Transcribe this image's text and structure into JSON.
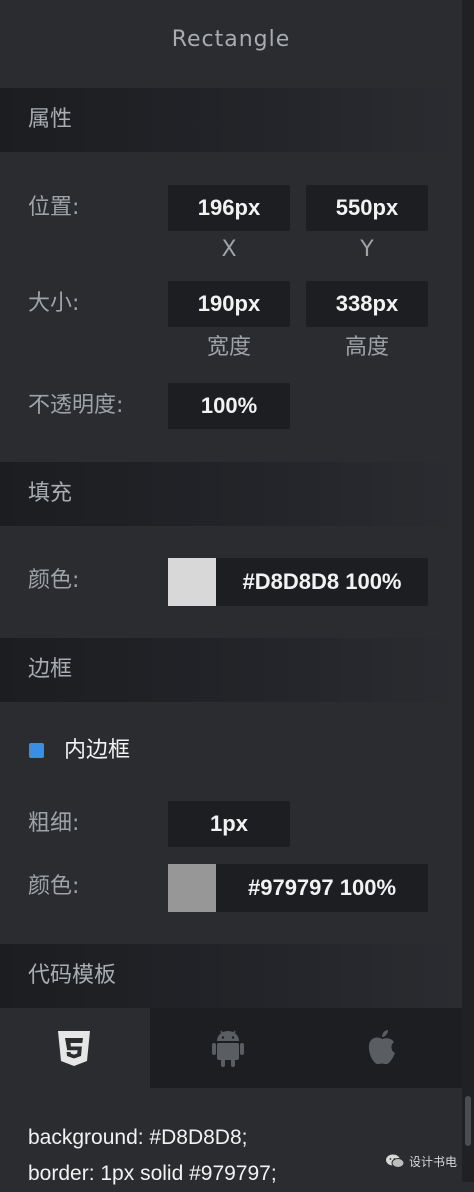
{
  "title": "Rectangle",
  "sections": {
    "properties": "属性",
    "fill": "填充",
    "border": "边框",
    "code_template": "代码模板"
  },
  "properties": {
    "position_label": "位置:",
    "x_value": "196px",
    "y_value": "550px",
    "x_caption": "X",
    "y_caption": "Y",
    "size_label": "大小:",
    "width_value": "190px",
    "height_value": "338px",
    "width_caption": "宽度",
    "height_caption": "高度",
    "opacity_label": "不透明度:",
    "opacity_value": "100%"
  },
  "fill": {
    "color_label": "颜色:",
    "color_hex": "#D8D8D8",
    "color_value": "#D8D8D8 100%"
  },
  "border": {
    "inner_border_label": "内边框",
    "inner_border_enabled": true,
    "thickness_label": "粗细:",
    "thickness_value": "1px",
    "color_label": "颜色:",
    "color_hex": "#979797",
    "color_value": "#979797 100%"
  },
  "code_tabs": [
    {
      "icon": "css3-icon",
      "active": true
    },
    {
      "icon": "android-icon",
      "active": false
    },
    {
      "icon": "apple-icon",
      "active": false
    }
  ],
  "code": {
    "line1": "background: #D8D8D8;",
    "line2": "border: 1px solid #979797;"
  },
  "watermark": {
    "icon": "wechat-icon",
    "text": "设计书电"
  },
  "colors": {
    "accent": "#3a8ee6",
    "panel_bg": "#2a2c30",
    "field_bg": "#1c1e22"
  }
}
